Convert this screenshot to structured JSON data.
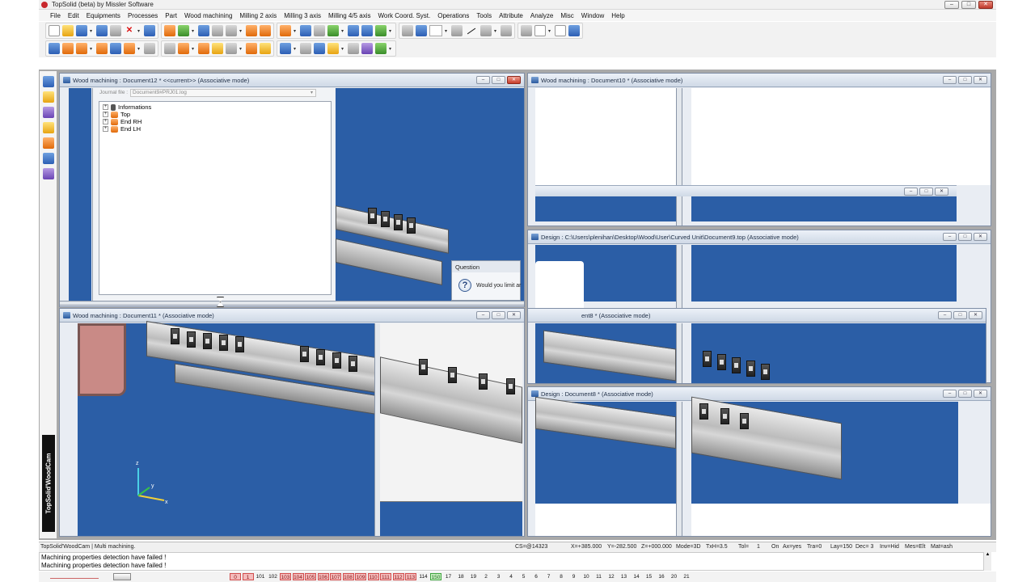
{
  "app": {
    "title": "TopSolid (beta) by Missler Software",
    "window_buttons": [
      "–",
      "□",
      "✕"
    ]
  },
  "menu": [
    "File",
    "Edit",
    "Equipments",
    "Processes",
    "Part",
    "Wood machining",
    "Milling 2 axis",
    "Milling 3 axis",
    "Milling 4/5 axis",
    "Work Coord. Syst.",
    "Operations",
    "Tools",
    "Attribute",
    "Analyze",
    "Misc",
    "Window",
    "Help"
  ],
  "toolbar1_icons": [
    "new-icon",
    "open-icon",
    "save-icon",
    "properties-icon",
    "print-icon",
    "delete-icon",
    "undo-icon",
    "edit-icon",
    "refresh-icon",
    "find-icon",
    "tools-icon",
    "options-icon",
    "draw-icon",
    "shape-icon",
    "move-icon",
    "hide-icon",
    "measure-icon",
    "grid-icon",
    "zoom-icon",
    "fit-icon",
    "render-icon",
    "view-icon",
    "pointer-icon",
    "color-icon",
    "dot-icon",
    "line-icon",
    "hatch-icon",
    "layer-icon",
    "filter-icon",
    "report-icon",
    "document-icon",
    "help-icon"
  ],
  "toolbar2_icons": [
    "machine-icon",
    "stock-icon",
    "fixture-icon",
    "clamp-icon",
    "table-icon",
    "part-icon",
    "tool-icon",
    "spindle-icon",
    "drill-icon",
    "saw-icon",
    "cut-icon",
    "pocket-icon",
    "contour-icon",
    "face-icon",
    "simulate-icon",
    "verify-icon",
    "postprocess-icon",
    "layers-icon",
    "sequence-icon",
    "settings-icon",
    "ok-icon"
  ],
  "sidebar": {
    "label": "TopSolid'WoodCam",
    "icons": [
      "sidebar-doc-icon",
      "sidebar-machining-icon",
      "sidebar-tools-icon",
      "sidebar-edit-icon",
      "sidebar-pen-icon",
      "sidebar-cube-icon",
      "sidebar-gear-icon"
    ]
  },
  "windows": {
    "doc12": {
      "title": "Wood machining : Document12 * <<current>> (Associative mode)",
      "journal_label": "Journal file :",
      "journal_value": "Document9#PRJ01.log",
      "tree": [
        "Informations",
        "Top",
        "End RH",
        "End LH"
      ]
    },
    "doc10": {
      "title": "Wood machining : Document10 * (Associative mode)"
    },
    "doc9": {
      "title": "Design : C:\\Users\\plenihan\\Desktop\\Wood\\User\\Curved Unit\\Document9.top (Associative mode)"
    },
    "doc11": {
      "title": "Wood machining : Document11 * (Associative mode)"
    },
    "doc8a": {
      "title": "ent8 * (Associative mode)"
    },
    "doc8b": {
      "title": "Design : Document8 * (Associative mode)"
    }
  },
  "question": {
    "title": "Question",
    "text": "Would you limit ar"
  },
  "axes": {
    "z": "z",
    "y": "y",
    "x": "x"
  },
  "status": {
    "app_mode": "TopSolid'WoodCam | Multi machining.",
    "cs": "CS=@14323",
    "x": "X=+385.000",
    "y": "Y=-282.500",
    "z": "Z=+000.000",
    "mode": "Mode=3D",
    "txh": "TxH=3.5",
    "tol_label": "Tol=",
    "tol_value": "1",
    "on": "On",
    "ax": "Ax=yes",
    "tra": "Tra=0",
    "lay": "Lay=150",
    "dec": "Dec= 3",
    "inv": "Inv=Hid",
    "mes": "Mes=Elt",
    "mat": "Mat=ash"
  },
  "messages": [
    "Machining properties detection have failed !",
    "Machining properties detection have failed !"
  ],
  "layers": [
    {
      "label": "0",
      "state": "red"
    },
    {
      "label": "1",
      "state": "red"
    },
    {
      "label": "101",
      "state": "plain"
    },
    {
      "label": "102",
      "state": "plain"
    },
    {
      "label": "103",
      "state": "red"
    },
    {
      "label": "104",
      "state": "red"
    },
    {
      "label": "105",
      "state": "red"
    },
    {
      "label": "106",
      "state": "red"
    },
    {
      "label": "107",
      "state": "red"
    },
    {
      "label": "108",
      "state": "red"
    },
    {
      "label": "109",
      "state": "red"
    },
    {
      "label": "110",
      "state": "red"
    },
    {
      "label": "111",
      "state": "red"
    },
    {
      "label": "112",
      "state": "red"
    },
    {
      "label": "113",
      "state": "red"
    },
    {
      "label": "114",
      "state": "plain"
    },
    {
      "label": "150",
      "state": "grn"
    },
    {
      "label": "17",
      "state": "plain"
    },
    {
      "label": "18",
      "state": "plain"
    },
    {
      "label": "19",
      "state": "plain"
    },
    {
      "label": "2",
      "state": "plain"
    },
    {
      "label": "3",
      "state": "plain"
    },
    {
      "label": "4",
      "state": "plain"
    },
    {
      "label": "5",
      "state": "plain"
    },
    {
      "label": "6",
      "state": "plain"
    },
    {
      "label": "7",
      "state": "plain"
    },
    {
      "label": "8",
      "state": "plain"
    },
    {
      "label": "9",
      "state": "plain"
    },
    {
      "label": "10",
      "state": "plain"
    },
    {
      "label": "11",
      "state": "plain"
    },
    {
      "label": "12",
      "state": "plain"
    },
    {
      "label": "13",
      "state": "plain"
    },
    {
      "label": "14",
      "state": "plain"
    },
    {
      "label": "15",
      "state": "plain"
    },
    {
      "label": "16",
      "state": "plain"
    },
    {
      "label": "20",
      "state": "plain"
    },
    {
      "label": "21",
      "state": "plain"
    }
  ],
  "colors": {
    "viewport_blue": "#2b5ea6",
    "caption": "#cfd9e6",
    "layer_active": "#c8f0c0",
    "layer_off": "#f4bcbc"
  }
}
